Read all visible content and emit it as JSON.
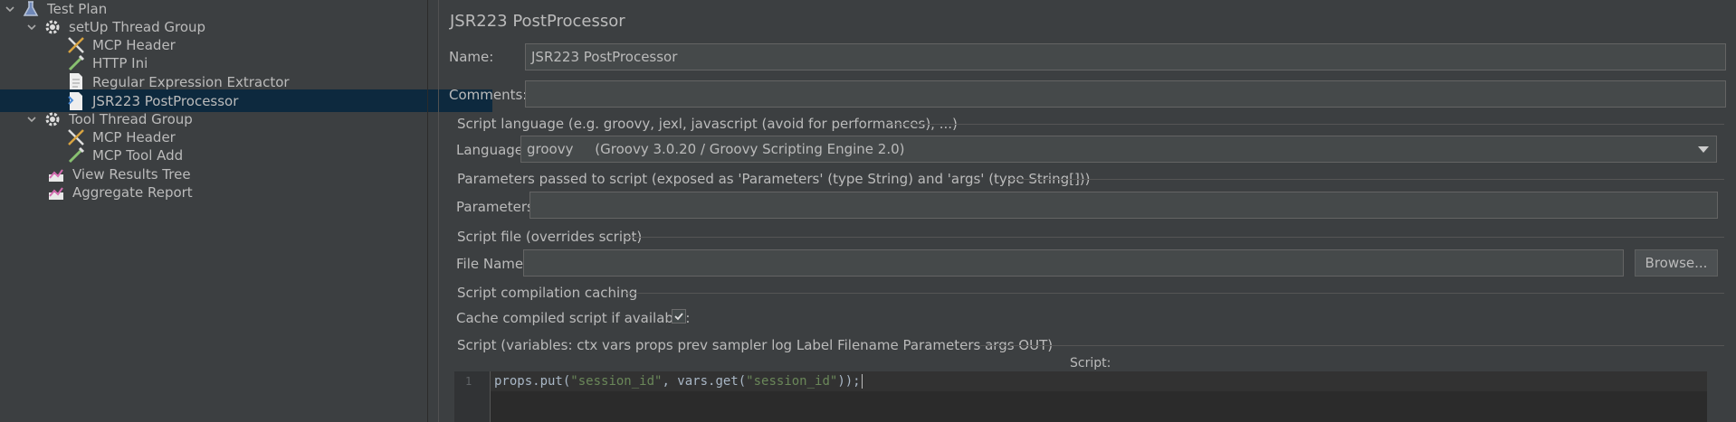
{
  "tree": [
    {
      "label": "Test Plan",
      "icon": "flask-icon",
      "expanded": true
    },
    {
      "label": "setUp Thread Group",
      "icon": "gear-icon",
      "expanded": true
    },
    {
      "label": "MCP Header",
      "icon": "tools-icon"
    },
    {
      "label": "HTTP Ini",
      "icon": "pipette-icon"
    },
    {
      "label": "Regular Expression Extractor",
      "icon": "document-icon"
    },
    {
      "label": "JSR223 PostProcessor",
      "icon": "script-document-icon",
      "selected": true
    },
    {
      "label": "Tool Thread Group",
      "icon": "gear-icon",
      "expanded": true
    },
    {
      "label": "MCP Header",
      "icon": "tools-icon"
    },
    {
      "label": "MCP Tool Add",
      "icon": "pipette-icon"
    },
    {
      "label": "View Results Tree",
      "icon": "chart-icon"
    },
    {
      "label": "Aggregate Report",
      "icon": "chart-icon"
    }
  ],
  "panel": {
    "title": "JSR223 PostProcessor",
    "name_label": "Name:",
    "name_value": "JSR223 PostProcessor",
    "comments_label": "Comments:",
    "comments_value": "",
    "script_language_section": "Script language (e.g. groovy, jexl, javascript (avoid for performances), ...)",
    "language_label": "Language:",
    "language_value": "groovy     (Groovy 3.0.20 / Groovy Scripting Engine 2.0)",
    "parameters_section": "Parameters passed to script (exposed as 'Parameters' (type String) and 'args' (type String[]))",
    "parameters_label": "Parameters:",
    "parameters_value": "",
    "script_file_section": "Script file (overrides script)",
    "file_name_label": "File Name:",
    "file_name_value": "",
    "browse_button": "Browse...",
    "caching_section": "Script compilation caching",
    "cache_label": "Cache compiled script if available:",
    "cache_checked": true,
    "script_section": "Script (variables: ctx vars props prev sampler log Label Filename Parameters args OUT)",
    "script_header": "Script:",
    "editor": {
      "line_number": "1",
      "code_prefix": "props.put(",
      "code_str1": "\"session_id\"",
      "code_mid": ", vars.get(",
      "code_str2": "\"session_id\"",
      "code_suffix": "));"
    }
  }
}
